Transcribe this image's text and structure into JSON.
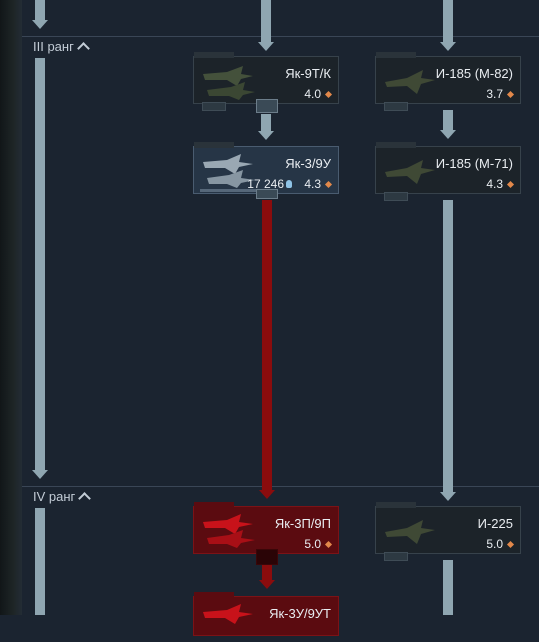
{
  "ranks": [
    {
      "label": "III ранг"
    },
    {
      "label": "IV ранг"
    }
  ],
  "vehicles": {
    "yak9tk": {
      "name": "Як-9Т/К",
      "br": "4.0"
    },
    "i185m82": {
      "name": "И-185 (М-82)",
      "br": "3.7"
    },
    "yak3_9u": {
      "name": "Як-3/9У",
      "br": "4.3",
      "research": "17 246"
    },
    "i185m71": {
      "name": "И-185 (М-71)",
      "br": "4.3"
    },
    "yak3p": {
      "name": "Як-3П/9П",
      "br": "5.0"
    },
    "i225": {
      "name": "И-225",
      "br": "5.0"
    },
    "yak3u": {
      "name": "Як-3У/9УТ"
    }
  },
  "colors": {
    "link_line": "#8fa6b1",
    "researching_line": "#8a0c0d",
    "br_diamond": "#e2884a"
  },
  "icons": [
    "plane-icon",
    "research-bulb-icon",
    "br-diamond-icon",
    "chevron-up-icon"
  ]
}
